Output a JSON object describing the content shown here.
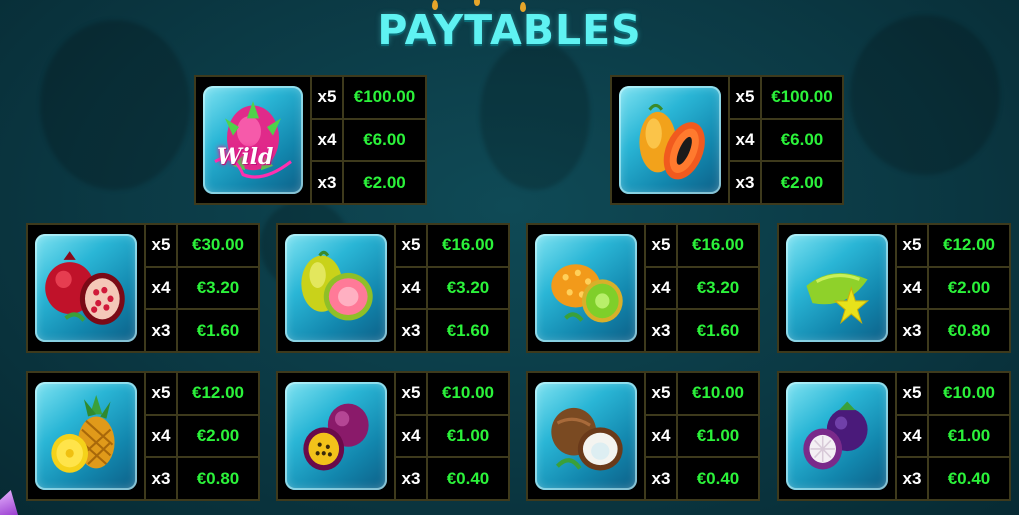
{
  "title": "PAYTABLES",
  "colors": {
    "title": "#5ff2f2",
    "payout": "#2bf23a",
    "multiplier": "#ffffff",
    "border": "#3e3a1c",
    "background": "#0b3944"
  },
  "symbols": [
    {
      "id": "wild",
      "name": "dragon-fruit-wild",
      "icon": "dragon-fruit-icon",
      "label": "Wild",
      "payouts": [
        {
          "mult": "x5",
          "value": "€100.00"
        },
        {
          "mult": "x4",
          "value": "€6.00"
        },
        {
          "mult": "x3",
          "value": "€2.00"
        }
      ]
    },
    {
      "id": "papaya",
      "name": "papaya",
      "icon": "papaya-icon",
      "payouts": [
        {
          "mult": "x5",
          "value": "€100.00"
        },
        {
          "mult": "x4",
          "value": "€6.00"
        },
        {
          "mult": "x3",
          "value": "€2.00"
        }
      ]
    },
    {
      "id": "pomegranate",
      "name": "pomegranate",
      "icon": "pomegranate-icon",
      "payouts": [
        {
          "mult": "x5",
          "value": "€30.00"
        },
        {
          "mult": "x4",
          "value": "€3.20"
        },
        {
          "mult": "x3",
          "value": "€1.60"
        }
      ]
    },
    {
      "id": "guava",
      "name": "guava",
      "icon": "guava-icon",
      "payouts": [
        {
          "mult": "x5",
          "value": "€16.00"
        },
        {
          "mult": "x4",
          "value": "€3.20"
        },
        {
          "mult": "x3",
          "value": "€1.60"
        }
      ]
    },
    {
      "id": "kiwano",
      "name": "kiwano",
      "icon": "kiwano-icon",
      "payouts": [
        {
          "mult": "x5",
          "value": "€16.00"
        },
        {
          "mult": "x4",
          "value": "€3.20"
        },
        {
          "mult": "x3",
          "value": "€1.60"
        }
      ]
    },
    {
      "id": "starfruit",
      "name": "starfruit",
      "icon": "starfruit-icon",
      "payouts": [
        {
          "mult": "x5",
          "value": "€12.00"
        },
        {
          "mult": "x4",
          "value": "€2.00"
        },
        {
          "mult": "x3",
          "value": "€0.80"
        }
      ]
    },
    {
      "id": "pineapple",
      "name": "pineapple",
      "icon": "pineapple-icon",
      "payouts": [
        {
          "mult": "x5",
          "value": "€12.00"
        },
        {
          "mult": "x4",
          "value": "€2.00"
        },
        {
          "mult": "x3",
          "value": "€0.80"
        }
      ]
    },
    {
      "id": "passionfruit",
      "name": "passionfruit",
      "icon": "passionfruit-icon",
      "payouts": [
        {
          "mult": "x5",
          "value": "€10.00"
        },
        {
          "mult": "x4",
          "value": "€1.00"
        },
        {
          "mult": "x3",
          "value": "€0.40"
        }
      ]
    },
    {
      "id": "coconut",
      "name": "coconut",
      "icon": "coconut-icon",
      "payouts": [
        {
          "mult": "x5",
          "value": "€10.00"
        },
        {
          "mult": "x4",
          "value": "€1.00"
        },
        {
          "mult": "x3",
          "value": "€0.40"
        }
      ]
    },
    {
      "id": "mangosteen",
      "name": "mangosteen",
      "icon": "mangosteen-icon",
      "payouts": [
        {
          "mult": "x5",
          "value": "€10.00"
        },
        {
          "mult": "x4",
          "value": "€1.00"
        },
        {
          "mult": "x3",
          "value": "€0.40"
        }
      ]
    }
  ]
}
